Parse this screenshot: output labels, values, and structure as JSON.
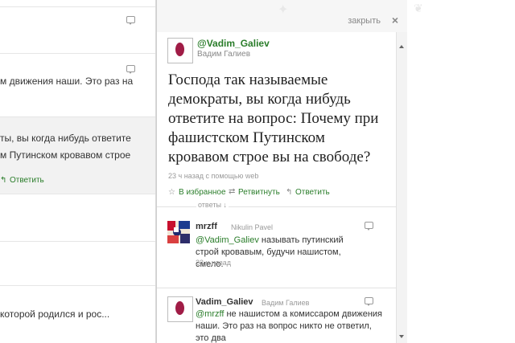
{
  "left_timeline": {
    "rows": [
      {
        "lines": []
      },
      {
        "lines": [
          "м движения наши. Это раз на"
        ]
      },
      {
        "lines": [
          "ты, вы когда нибудь ответите",
          "м Путинском кровавом строе"
        ],
        "reply_label": "Ответить"
      },
      {
        "lines": []
      },
      {
        "lines": []
      },
      {
        "lines": [
          "которой родился и рос..."
        ]
      }
    ]
  },
  "detail": {
    "close_label": "закрыть",
    "close_icon": "×",
    "main_tweet": {
      "username": "@Vadim_Galiev",
      "fullname": "Вадим Галиев",
      "text": "Господа так называемые демократы, вы когда нибудь ответите на вопрос: Почему при фашистском Путинском кровавом строе вы на свободе?",
      "meta": "23 ч назад с помощью web",
      "actions": {
        "favorite": "В избранное",
        "retweet": "Ретвитнуть",
        "reply": "Ответить"
      }
    },
    "replies_label": "ответы ↓",
    "replies": [
      {
        "username": "mrzff",
        "fullname": "Nikulin Pavel",
        "mention": "@Vadim_Galiev",
        "text": " называть путинский строй кровавым, будучи нашистом, смело.",
        "time": "23 ч назад"
      },
      {
        "username": "Vadim_Galiev",
        "fullname": "Вадим Галиев",
        "mention": "@mrzff",
        "text": " не нашистом а комиссаром движения наши. Это раз на вопрос никто не ответил, это два",
        "time": ""
      }
    ]
  },
  "colors": {
    "link_green": "#2a7d2a",
    "avatar_egg": "#a01c46",
    "meta_gray": "#999999"
  }
}
